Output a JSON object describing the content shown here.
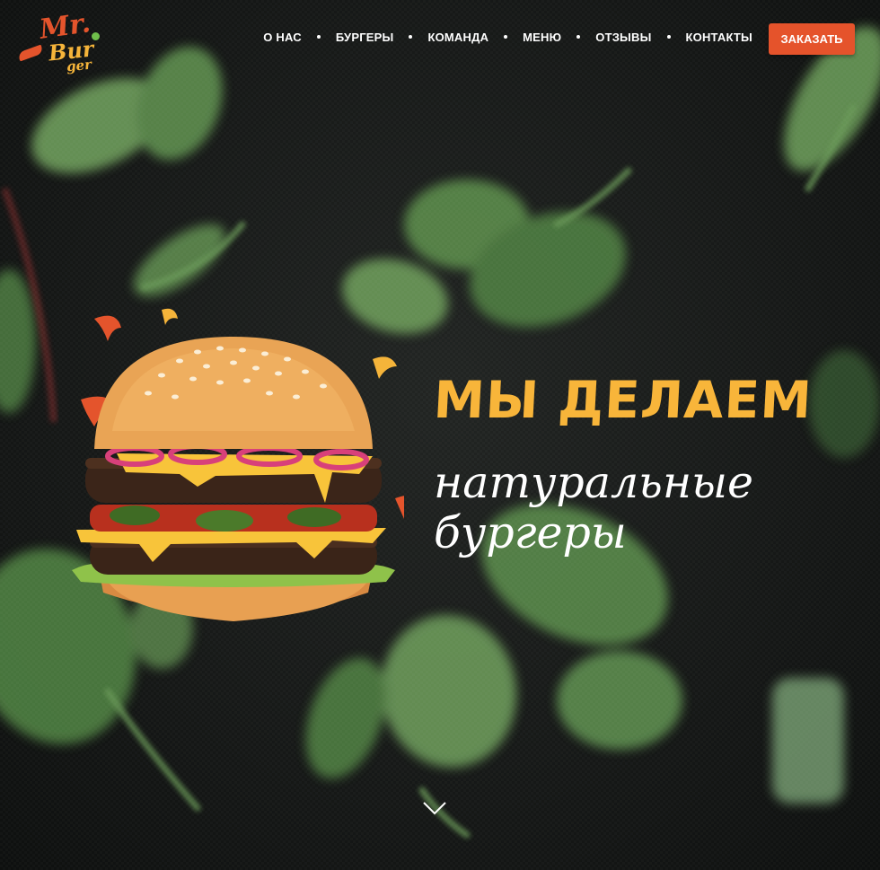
{
  "brand": {
    "logo_line1": "Mr.",
    "logo_line2": "Bur",
    "logo_line3": "ger"
  },
  "nav": {
    "items": [
      {
        "label": "О НАС"
      },
      {
        "label": "БУРГЕРЫ"
      },
      {
        "label": "КОМАНДА"
      },
      {
        "label": "МЕНЮ"
      },
      {
        "label": "ОТЗЫВЫ"
      },
      {
        "label": "КОНТАКТЫ"
      }
    ],
    "order_label": "ЗАКАЗАТЬ"
  },
  "hero": {
    "title": "МЫ ДЕЛАЕМ",
    "subtitle": "натуральные бургеры"
  },
  "icons": {
    "scroll_down": "chevron-down-icon"
  },
  "colors": {
    "accent": "#e5532b",
    "yellow": "#f8b53a",
    "leaf": "#5a8a4c",
    "background": "#151716"
  }
}
